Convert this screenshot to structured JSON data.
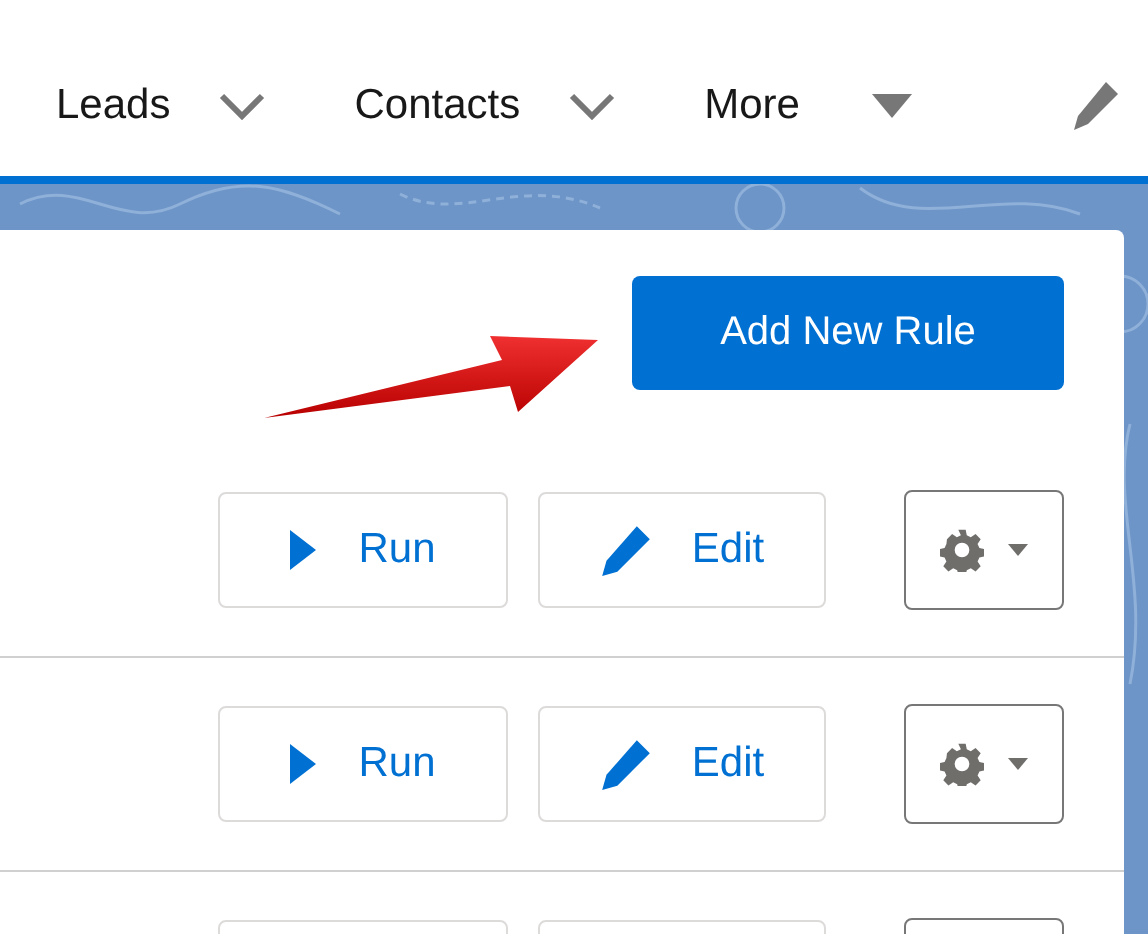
{
  "nav": {
    "items": [
      {
        "label": "Leads",
        "kind": "chevron"
      },
      {
        "label": "Contacts",
        "kind": "chevron"
      },
      {
        "label": "More",
        "kind": "triangle"
      }
    ]
  },
  "header": {
    "add_button": "Add New Rule"
  },
  "rows": [
    {
      "kind": "full",
      "run": "Run",
      "edit": "Edit"
    },
    {
      "kind": "full",
      "run": "Run",
      "edit": "Edit"
    },
    {
      "kind": "cut"
    }
  ]
}
